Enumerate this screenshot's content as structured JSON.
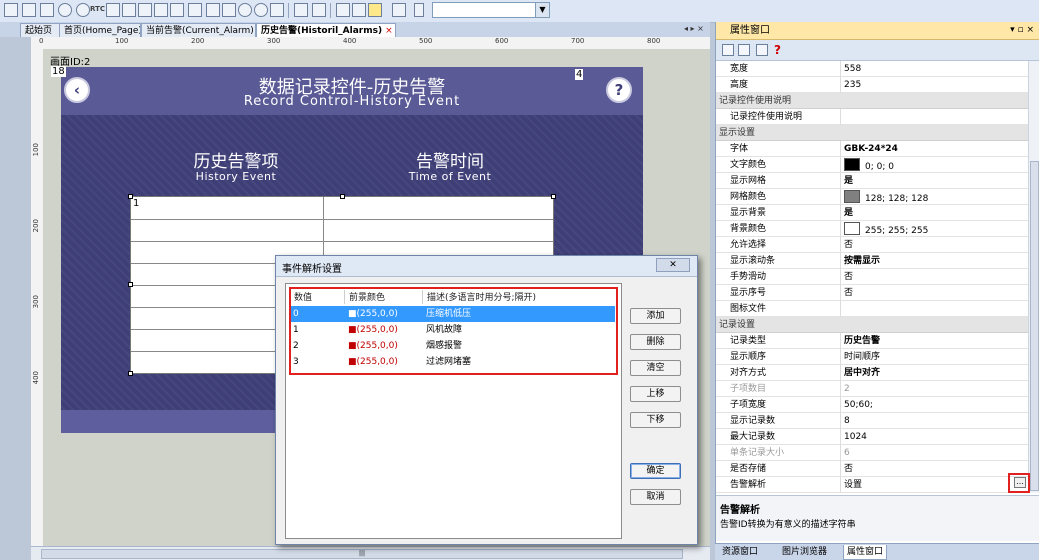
{
  "toolbar": {
    "rtc_label": "RTC"
  },
  "doc_tabs": [
    {
      "label": "起始页",
      "active": false
    },
    {
      "label": "首页(Home_Page)",
      "active": false
    },
    {
      "label": "当前告警(Current_Alarm)",
      "active": false
    },
    {
      "label": "历史告警(Historil_Alarms)",
      "active": true,
      "close": "×"
    }
  ],
  "tab_nav": "◂ ▸ ×",
  "ruler_top": [
    "0",
    "100",
    "200",
    "300",
    "400",
    "500",
    "600",
    "700",
    "800"
  ],
  "ruler_left": [
    "100",
    "200",
    "300",
    "400"
  ],
  "canvas": {
    "screen_id": "画面ID:2",
    "badge_left": "18",
    "badge_right": "4",
    "title_cn": "数据记录控件-历史告警",
    "title_en": "Record Control-History Event",
    "back_glyph": "‹",
    "help_glyph": "?",
    "col1_cn": "历史告警项",
    "col1_en": "History Event",
    "col2_cn": "告警时间",
    "col2_en": "Time of Event",
    "table_first_cell": "1"
  },
  "props": {
    "title": "属性窗口",
    "title_controls": "▾ ▫ ×",
    "help_glyph": "?",
    "rows": [
      {
        "kind": "prop",
        "name": "宽度",
        "value": "558"
      },
      {
        "kind": "prop",
        "name": "高度",
        "value": "235"
      },
      {
        "kind": "cat",
        "name": "记录控件使用说明"
      },
      {
        "kind": "prop",
        "name": "记录控件使用说明",
        "value": ""
      },
      {
        "kind": "cat",
        "name": "显示设置"
      },
      {
        "kind": "prop",
        "name": "字体",
        "value": "GBK-24*24",
        "bold": true
      },
      {
        "kind": "prop",
        "name": "文字颜色",
        "value": "0; 0; 0",
        "swatch": "#000000"
      },
      {
        "kind": "prop",
        "name": "显示网格",
        "value": "是",
        "bold": true
      },
      {
        "kind": "prop",
        "name": "网格颜色",
        "value": "128; 128; 128",
        "swatch": "#808080"
      },
      {
        "kind": "prop",
        "name": "显示背景",
        "value": "是",
        "bold": true
      },
      {
        "kind": "prop",
        "name": "背景颜色",
        "value": "255; 255; 255",
        "swatch": "#ffffff"
      },
      {
        "kind": "prop",
        "name": "允许选择",
        "value": "否"
      },
      {
        "kind": "prop",
        "name": "显示滚动条",
        "value": "按需显示",
        "bold": true
      },
      {
        "kind": "prop",
        "name": "手势滑动",
        "value": "否"
      },
      {
        "kind": "prop",
        "name": "显示序号",
        "value": "否"
      },
      {
        "kind": "prop",
        "name": "图标文件",
        "value": ""
      },
      {
        "kind": "cat",
        "name": "记录设置"
      },
      {
        "kind": "prop",
        "name": "记录类型",
        "value": "历史告警",
        "bold": true
      },
      {
        "kind": "prop",
        "name": "显示顺序",
        "value": "时间顺序"
      },
      {
        "kind": "prop",
        "name": "对齐方式",
        "value": "居中对齐",
        "bold": true
      },
      {
        "kind": "prop",
        "name": "子项数目",
        "value": "2",
        "dim": true
      },
      {
        "kind": "prop",
        "name": "子项宽度",
        "value": "50;60;"
      },
      {
        "kind": "prop",
        "name": "显示记录数",
        "value": "8"
      },
      {
        "kind": "prop",
        "name": "最大记录数",
        "value": "1024"
      },
      {
        "kind": "prop",
        "name": "单条记录大小",
        "value": "6",
        "dim": true
      },
      {
        "kind": "prop",
        "name": "是否存储",
        "value": "否"
      },
      {
        "kind": "prop",
        "name": "告警解析",
        "value": "设置"
      }
    ],
    "ellipsis": "...",
    "desc_title": "告警解析",
    "desc_text": "告警ID转换为有意义的描述字符串"
  },
  "bottom_tabs": [
    {
      "label": "资源窗口",
      "active": false
    },
    {
      "label": "图片浏览器",
      "active": false
    },
    {
      "label": "属性窗口",
      "active": true
    }
  ],
  "hscroll_thumb": "|||",
  "dialog": {
    "title": "事件解析设置",
    "close": "✕",
    "headers": [
      "数值",
      "前景颜色",
      "描述(多语言时用分号;隔开)"
    ],
    "rows": [
      {
        "value": "0",
        "color": "■(255,0,0)",
        "desc": "压缩机低压",
        "selected": true
      },
      {
        "value": "1",
        "color": "■(255,0,0)",
        "desc": "风机故障",
        "selected": false
      },
      {
        "value": "2",
        "color": "■(255,0,0)",
        "desc": "烟感报警",
        "selected": false
      },
      {
        "value": "3",
        "color": "■(255,0,0)",
        "desc": "过滤网堵塞",
        "selected": false
      }
    ],
    "buttons": {
      "add": "添加",
      "delete": "删除",
      "clear": "清空",
      "up": "上移",
      "down": "下移",
      "ok": "确定",
      "cancel": "取消"
    }
  },
  "colors": {
    "screen_bg": "#3f3f78",
    "highlight": "#e12020",
    "selection": "#3399ff"
  }
}
